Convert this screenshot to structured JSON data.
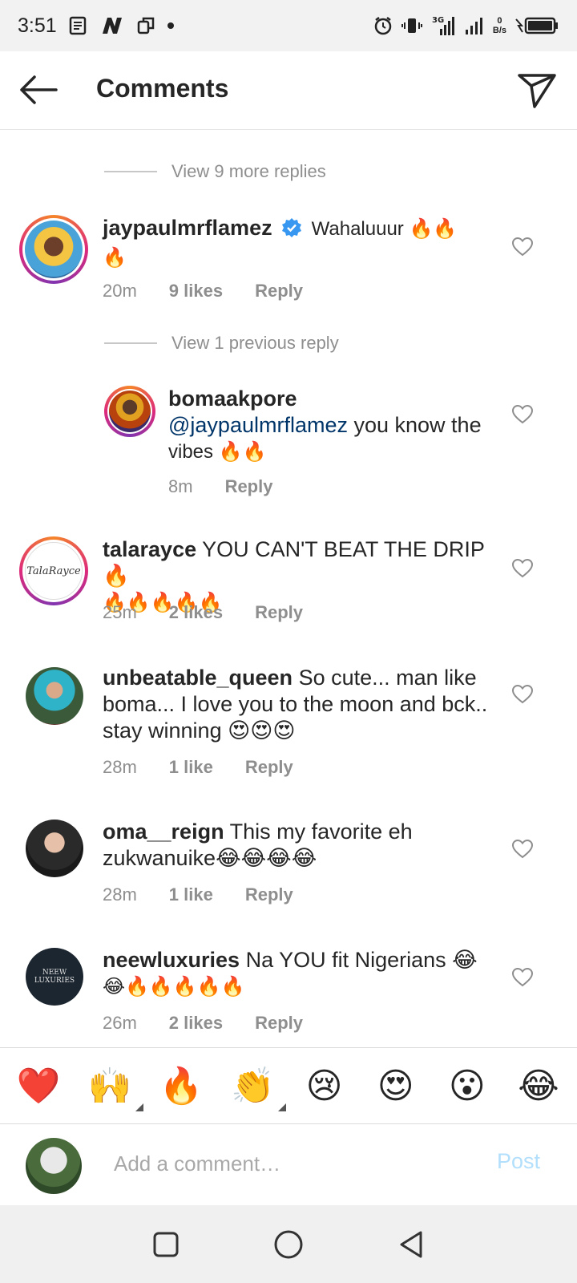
{
  "status_bar": {
    "time": "3:51",
    "net_speed_value": "0",
    "net_speed_unit": "B/s",
    "network_type": "3G"
  },
  "header": {
    "title": "Comments"
  },
  "threads": {
    "view_more_replies_top": "View 9 more replies",
    "view_previous_reply": "View 1 previous reply"
  },
  "comments": [
    {
      "username": "jaypaulmrflamez",
      "verified": true,
      "text_line1": "Wahaluuur 🔥🔥",
      "text_line2": "🔥",
      "time": "20m",
      "likes": "9 likes",
      "reply": "Reply"
    },
    {
      "username": "bomaakpore",
      "mention": "@jaypaulmrflamez",
      "text_line1": " you know the",
      "text_line2": "vibes 🔥🔥",
      "time": "8m",
      "reply": "Reply"
    },
    {
      "username": "talarayce",
      "text_line1": " YOU CAN'T BEAT THE DRIP🔥",
      "text_line2": "🔥🔥🔥🔥🔥",
      "time": "25m",
      "likes": "2 likes",
      "reply": "Reply",
      "avatar_text": "TalaRayce"
    },
    {
      "username": "unbeatable_queen",
      "text_line1": " So cute... man like",
      "text_line2": "boma... I love you to the moon and bck..",
      "text_line3": "stay winning 😍😍😍",
      "time": "28m",
      "likes": "1 like",
      "reply": "Reply"
    },
    {
      "username": "oma__reign",
      "text_line1": " This my favorite eh",
      "text_line2": "zukwanuike😂😂😂😂",
      "time": "28m",
      "likes": "1 like",
      "reply": "Reply"
    },
    {
      "username": "neewluxuries",
      "text_line1": " Na YOU fit Nigerians 😂",
      "text_line2": "😂🔥🔥🔥🔥🔥",
      "time": "26m",
      "likes": "2 likes",
      "reply": "Reply",
      "avatar_text_1": "NEEW",
      "avatar_text_2": "LUXURIES"
    }
  ],
  "quick_reactions": [
    "❤️",
    "🙌",
    "🔥",
    "👏",
    "😢",
    "😍",
    "😮",
    "😂"
  ],
  "composer": {
    "placeholder": "Add a comment…",
    "post_label": "Post"
  },
  "colors": {
    "text_primary": "#262626",
    "text_secondary": "#8e8e8e",
    "mention": "#003569",
    "post_disabled": "#b2dffc",
    "verified": "#3897f0",
    "story_ring_start": "#f58529",
    "story_ring_end": "#8134af"
  },
  "icons": {
    "back": "arrow-left-icon",
    "direct": "paper-plane-icon",
    "like": "heart-outline-icon",
    "verified": "verified-badge-icon"
  }
}
